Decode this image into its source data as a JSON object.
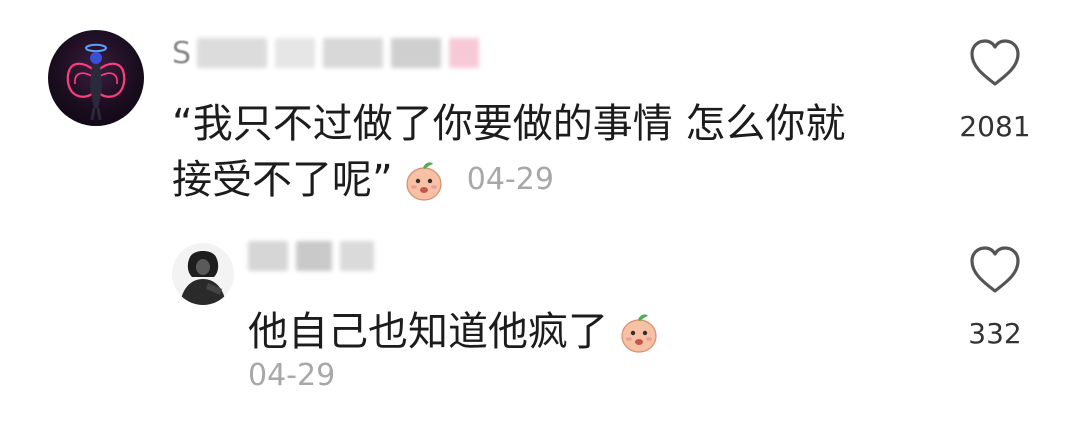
{
  "comments": [
    {
      "username_initial": "S",
      "text_line1": "“我只不过做了你要做的事情 怎么你就",
      "text_line2": "接受不了呢”",
      "emoji": "peach-emoji",
      "date": "04-29",
      "likes": "2081",
      "icon": "heart-outline-icon"
    },
    {
      "username_initial": "",
      "text": "他自己也知道他疯了",
      "emoji": "peach-emoji",
      "date": "04-29",
      "likes": "332",
      "icon": "heart-outline-icon"
    }
  ],
  "colors": {
    "text": "#1c1c1c",
    "date": "#a8a8a8",
    "like_count": "#333333",
    "heart": "#555555"
  }
}
